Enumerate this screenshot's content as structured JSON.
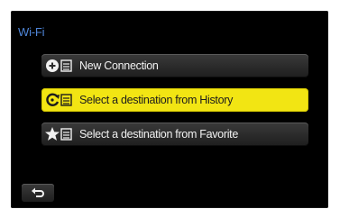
{
  "screen": {
    "title": "Wi-Fi"
  },
  "menu": {
    "items": [
      {
        "label": "New Connection",
        "icon": "plus-circle-list-icon",
        "selected": false
      },
      {
        "label": "Select a destination from History",
        "icon": "history-list-icon",
        "selected": true
      },
      {
        "label": "Select a destination from Favorite",
        "icon": "star-list-icon",
        "selected": false
      }
    ]
  },
  "footer": {
    "back_icon": "return-arrow-icon"
  },
  "colors": {
    "screen_background": "#000000",
    "title_text": "#4f86d9",
    "item_background": "#2c2c2c",
    "selected_background": "#f2e513",
    "item_text": "#f1f1f1",
    "selected_text": "#1c1c1c"
  }
}
